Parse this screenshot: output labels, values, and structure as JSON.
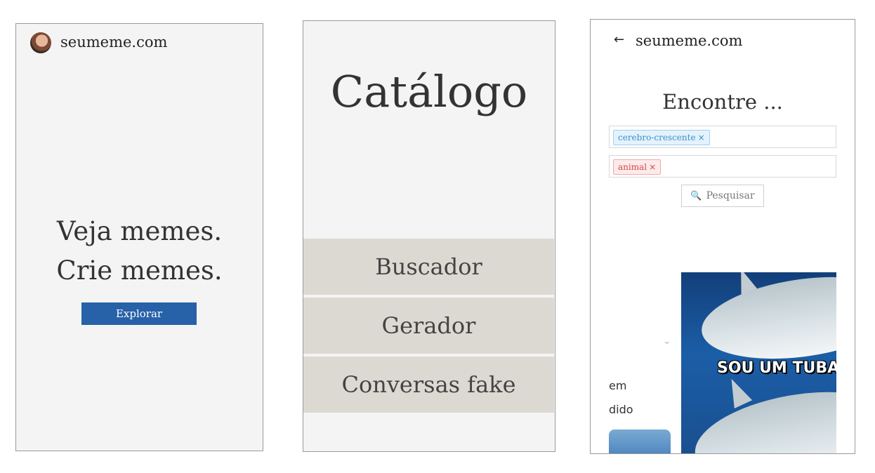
{
  "home": {
    "site_name": "seumeme.com",
    "tagline_1": "Veja memes.",
    "tagline_2": "Crie memes.",
    "explore_label": "Explorar"
  },
  "catalog": {
    "title": "Catálogo",
    "menu": [
      {
        "label": "Buscador"
      },
      {
        "label": "Gerador"
      },
      {
        "label": "Conversas fake"
      }
    ]
  },
  "search": {
    "site_name": "seumeme.com",
    "back_icon": "←",
    "heading": "Encontre ...",
    "tags": [
      {
        "label": "cerebro-crescente",
        "color": "#3e8fc9"
      },
      {
        "label": "animal",
        "color": "#d24b4b"
      }
    ],
    "remove_glyph": "×",
    "search_icon": "🔍",
    "search_label": "Pesquisar",
    "chevron": "⌄",
    "partial_text_1": "em",
    "partial_text_2": "dido",
    "meme_caption": "SOU UM TUBAR"
  }
}
